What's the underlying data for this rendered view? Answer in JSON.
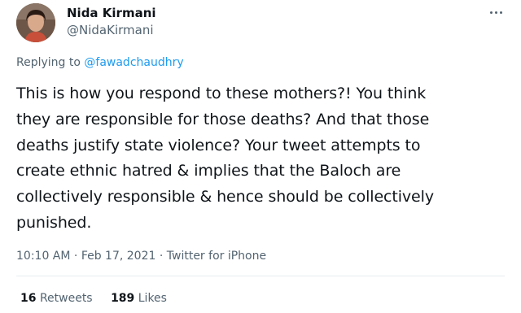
{
  "tweet": {
    "author": {
      "name": "Nida Kirmani",
      "handle": "@NidaKirmani",
      "avatar_icon": "profile-avatar"
    },
    "more_icon": "ellipsis-icon",
    "replying_to": {
      "prefix": "Replying to",
      "handle": "@fawadchaudhry"
    },
    "text_lines": [
      "This is how you respond to these mothers?! You think",
      "they are responsible for those deaths? And that those",
      "deaths justify state violence? Your tweet attempts to",
      "create ethnic hatred & implies that the Baloch are",
      "collectively responsible & hence should be collectively",
      "punished."
    ],
    "meta": {
      "time": "10:10 AM",
      "separator": "·",
      "date": "Feb 17, 2021",
      "source": "Twitter for iPhone"
    },
    "stats": {
      "retweets_count": "16",
      "retweets_label": "Retweets",
      "likes_count": "189",
      "likes_label": "Likes"
    }
  },
  "colors": {
    "primary_text": "#0f1419",
    "secondary_text": "#536471",
    "link": "#1d9bf0",
    "divider": "#e6ecf0"
  }
}
